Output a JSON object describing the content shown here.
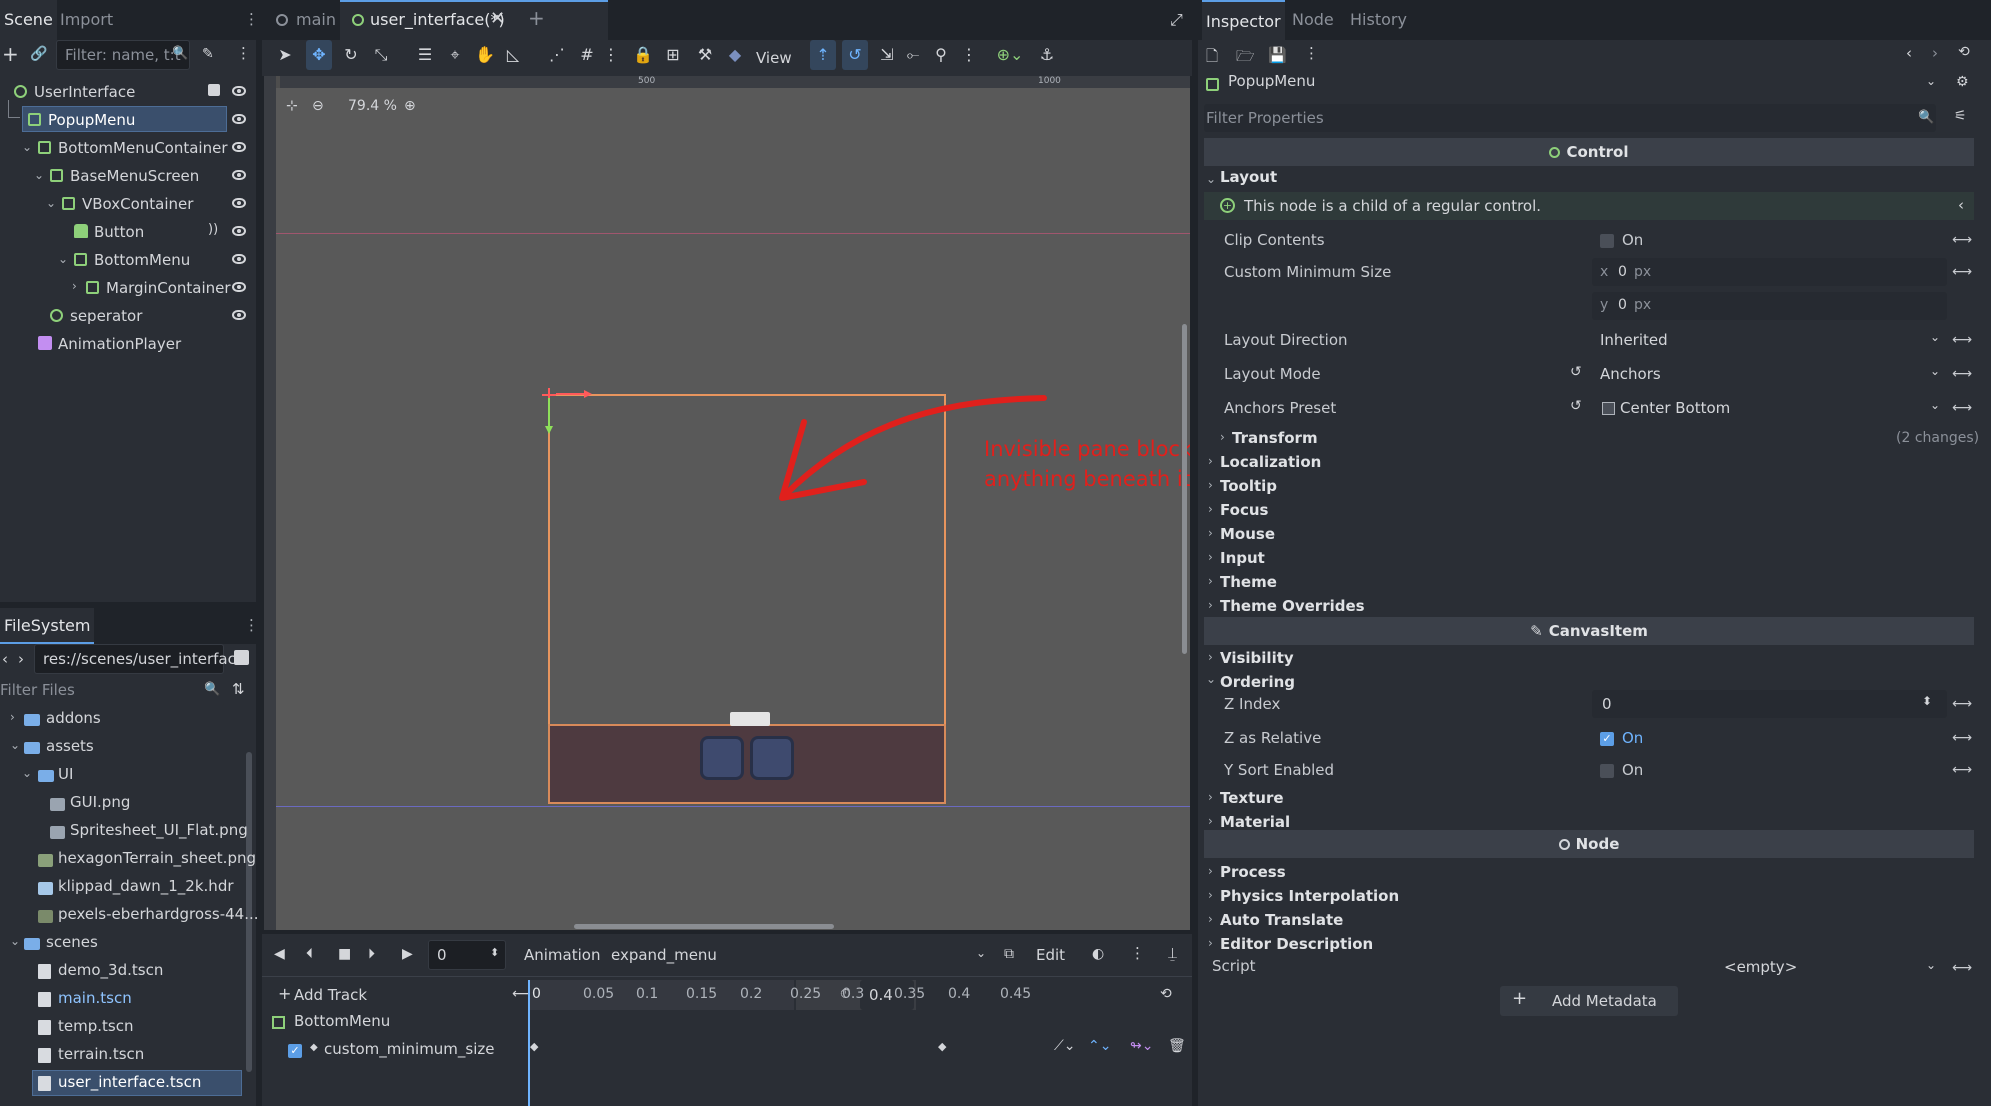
{
  "scene_dock": {
    "tabs": [
      "Scene",
      "Import"
    ],
    "filter_placeholder": "Filter: name, t:t",
    "tree": [
      {
        "label": "UserInterface"
      },
      {
        "label": "PopupMenu"
      },
      {
        "label": "BottomMenuContainer"
      },
      {
        "label": "BaseMenuScreen"
      },
      {
        "label": "VBoxContainer"
      },
      {
        "label": "Button"
      },
      {
        "label": "BottomMenu"
      },
      {
        "label": "MarginContainer"
      },
      {
        "label": "seperator"
      },
      {
        "label": "AnimationPlayer"
      }
    ]
  },
  "filesystem": {
    "tab": "FileSystem",
    "path": "res://scenes/user_interface.",
    "filter_placeholder": "Filter Files",
    "items": [
      {
        "label": "addons"
      },
      {
        "label": "assets"
      },
      {
        "label": "UI"
      },
      {
        "label": "GUI.png"
      },
      {
        "label": "Spritesheet_UI_Flat.png"
      },
      {
        "label": "hexagonTerrain_sheet.png"
      },
      {
        "label": "klippad_dawn_1_2k.hdr"
      },
      {
        "label": "pexels-eberhardgross-44..."
      },
      {
        "label": "scenes"
      },
      {
        "label": "demo_3d.tscn"
      },
      {
        "label": "main.tscn"
      },
      {
        "label": "temp.tscn"
      },
      {
        "label": "terrain.tscn"
      },
      {
        "label": "user_interface.tscn"
      }
    ]
  },
  "editor_tabs": [
    {
      "label": "main"
    },
    {
      "label": "user_interface(*)"
    }
  ],
  "toolbar": {
    "view_label": "View"
  },
  "viewport": {
    "zoom": "79.4 %",
    "ruler_marks": [
      "500",
      "1000"
    ],
    "annotation_line1": "Invisible pane blocks",
    "annotation_line2": "anything beneath it",
    "annotation_color": "#e0201c"
  },
  "animation": {
    "frame_value": "0",
    "animation_label": "Animation",
    "animation_name": "expand_menu",
    "edit_label": "Edit",
    "add_track_label": "Add Track",
    "ticks": [
      "0",
      "0.05",
      "0.1",
      "0.15",
      "0.2",
      "0.25",
      "0.3",
      "0.35",
      "0.4",
      "0.45"
    ],
    "length_value": "0.4",
    "track_group": "BottomMenu",
    "track_property": "custom_minimum_size"
  },
  "inspector": {
    "tabs": [
      "Inspector",
      "Node",
      "History"
    ],
    "node_name": "PopupMenu",
    "filter_placeholder": "Filter Properties",
    "control_header": "Control",
    "layout_section": "Layout",
    "layout_notice": "This node is a child of a regular control.",
    "clip_contents_label": "Clip Contents",
    "clip_contents_value": "On",
    "custom_min_size_label": "Custom Minimum Size",
    "min_x_axis": "x",
    "min_x_value": "0",
    "min_y_axis": "y",
    "min_y_value": "0",
    "px_unit": "px",
    "layout_direction_label": "Layout Direction",
    "layout_direction_value": "Inherited",
    "layout_mode_label": "Layout Mode",
    "layout_mode_value": "Anchors",
    "anchors_preset_label": "Anchors Preset",
    "anchors_preset_value": "Center Bottom",
    "transform_label": "Transform",
    "transform_changes": "(2 changes)",
    "sections_control": [
      "Localization",
      "Tooltip",
      "Focus",
      "Mouse",
      "Input",
      "Theme",
      "Theme Overrides"
    ],
    "canvasitem_header": "CanvasItem",
    "visibility_label": "Visibility",
    "ordering_label": "Ordering",
    "z_index_label": "Z Index",
    "z_index_value": "0",
    "z_relative_label": "Z as Relative",
    "z_relative_value": "On",
    "y_sort_label": "Y Sort Enabled",
    "y_sort_value": "On",
    "texture_label": "Texture",
    "material_label": "Material",
    "node_header": "Node",
    "sections_node": [
      "Process",
      "Physics Interpolation",
      "Auto Translate",
      "Editor Description"
    ],
    "script_label": "Script",
    "script_value": "<empty>",
    "add_metadata_label": "Add Metadata"
  }
}
